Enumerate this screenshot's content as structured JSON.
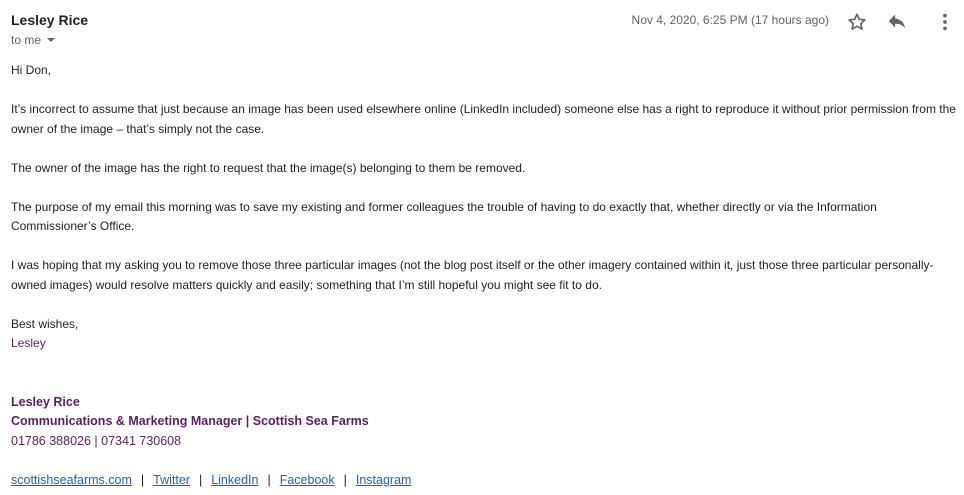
{
  "header": {
    "sender_name": "Lesley Rice",
    "recipient": "to me",
    "date": "Nov 4, 2020, 6:25 PM (17 hours ago)"
  },
  "icons": {
    "star": "star-icon",
    "reply": "reply-icon",
    "more": "more-vert-icon",
    "caret": "chevron-down-icon"
  },
  "message": {
    "greeting": "Hi Don,",
    "paragraphs": [
      "It’s incorrect to assume that just because an image has been used elsewhere online (LinkedIn included) someone else has a right to reproduce it without prior permission from the owner of the image – that’s simply not the case.",
      "The owner of the image has the right to request that the image(s) belonging to them be removed.",
      "The purpose of my email this morning was to save my existing and former colleagues the trouble of having to do exactly that, whether directly or via the Information Commissioner’s Office.",
      "I was hoping that my asking you to remove those three particular images (not the blog post itself or the other imagery contained within it, just those three particular personally-owned images) would resolve matters quickly and easily; something that I’m still hopeful you might see fit to do."
    ],
    "closing": "Best wishes,",
    "closing_name": "Lesley"
  },
  "signature": {
    "name": "Lesley Rice",
    "title": "Communications & Marketing Manager | Scottish Sea Farms",
    "phones": "01786 388026 | 07341 730608",
    "links": [
      "scottishseafarms.com",
      "Twitter",
      "LinkedIn",
      "Facebook",
      "Instagram"
    ],
    "link_separator": "|"
  },
  "colors": {
    "signature_purple": "#5b1f5f",
    "link_blue": "#2a5fa4",
    "meta_grey": "#5f6368"
  }
}
